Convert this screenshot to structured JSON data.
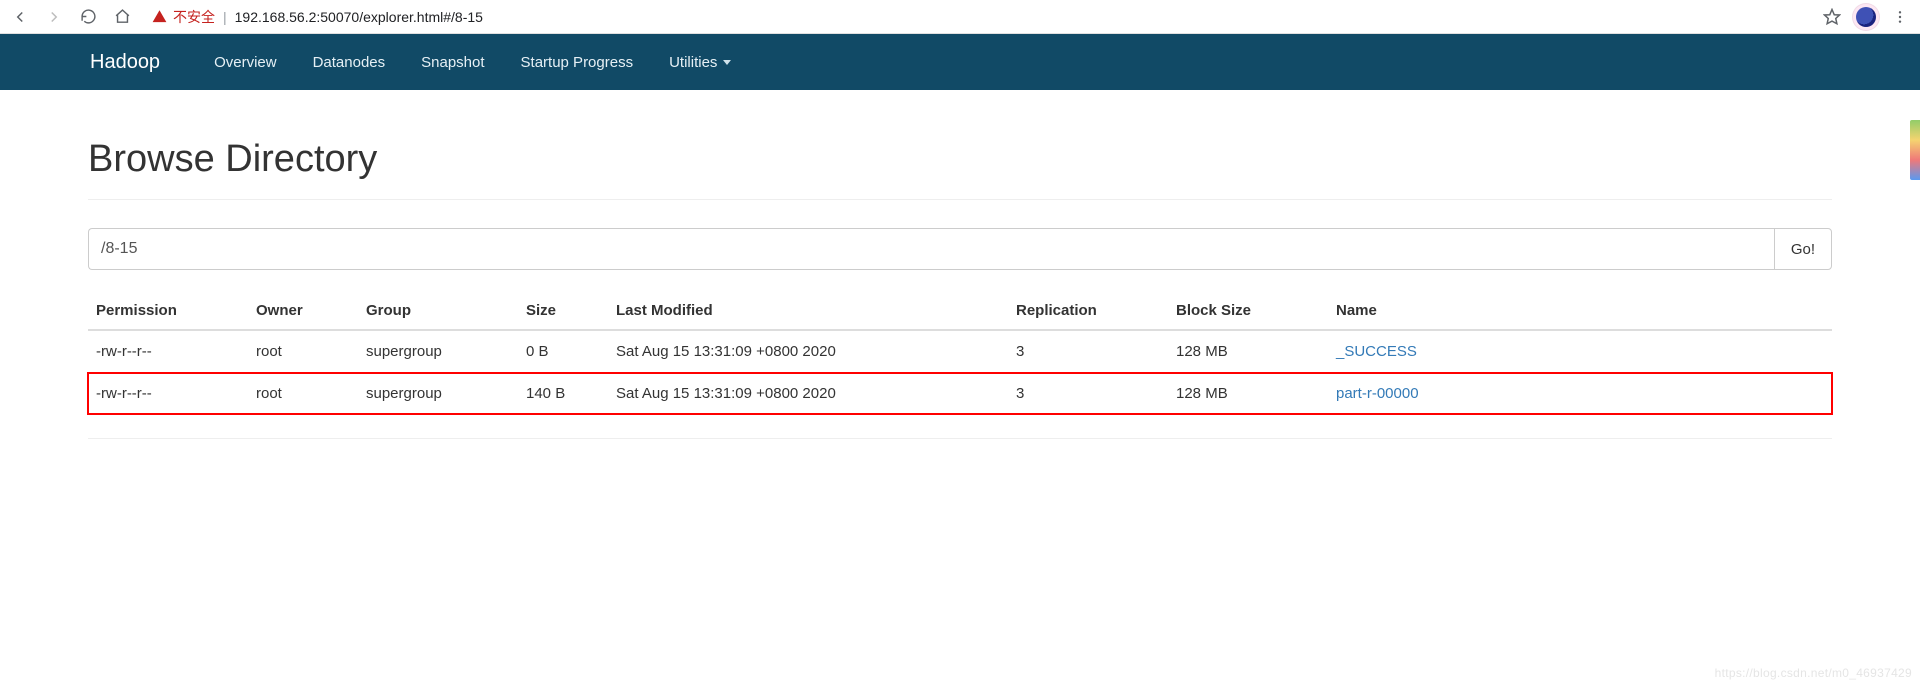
{
  "browser": {
    "not_secure_label": "不安全",
    "url": "192.168.56.2:50070/explorer.html#/8-15"
  },
  "nav": {
    "brand": "Hadoop",
    "items": [
      "Overview",
      "Datanodes",
      "Snapshot",
      "Startup Progress",
      "Utilities"
    ]
  },
  "page": {
    "title": "Browse Directory",
    "path_value": "/8-15",
    "go_label": "Go!"
  },
  "table": {
    "headers": [
      "Permission",
      "Owner",
      "Group",
      "Size",
      "Last Modified",
      "Replication",
      "Block Size",
      "Name"
    ],
    "rows": [
      {
        "permission": "-rw-r--r--",
        "owner": "root",
        "group": "supergroup",
        "size": "0 B",
        "last_modified": "Sat Aug 15 13:31:09 +0800 2020",
        "replication": "3",
        "block_size": "128 MB",
        "name": "_SUCCESS",
        "highlight": false
      },
      {
        "permission": "-rw-r--r--",
        "owner": "root",
        "group": "supergroup",
        "size": "140 B",
        "last_modified": "Sat Aug 15 13:31:09 +0800 2020",
        "replication": "3",
        "block_size": "128 MB",
        "name": "part-r-00000",
        "highlight": true
      }
    ]
  },
  "watermark": "https://blog.csdn.net/m0_46937429"
}
